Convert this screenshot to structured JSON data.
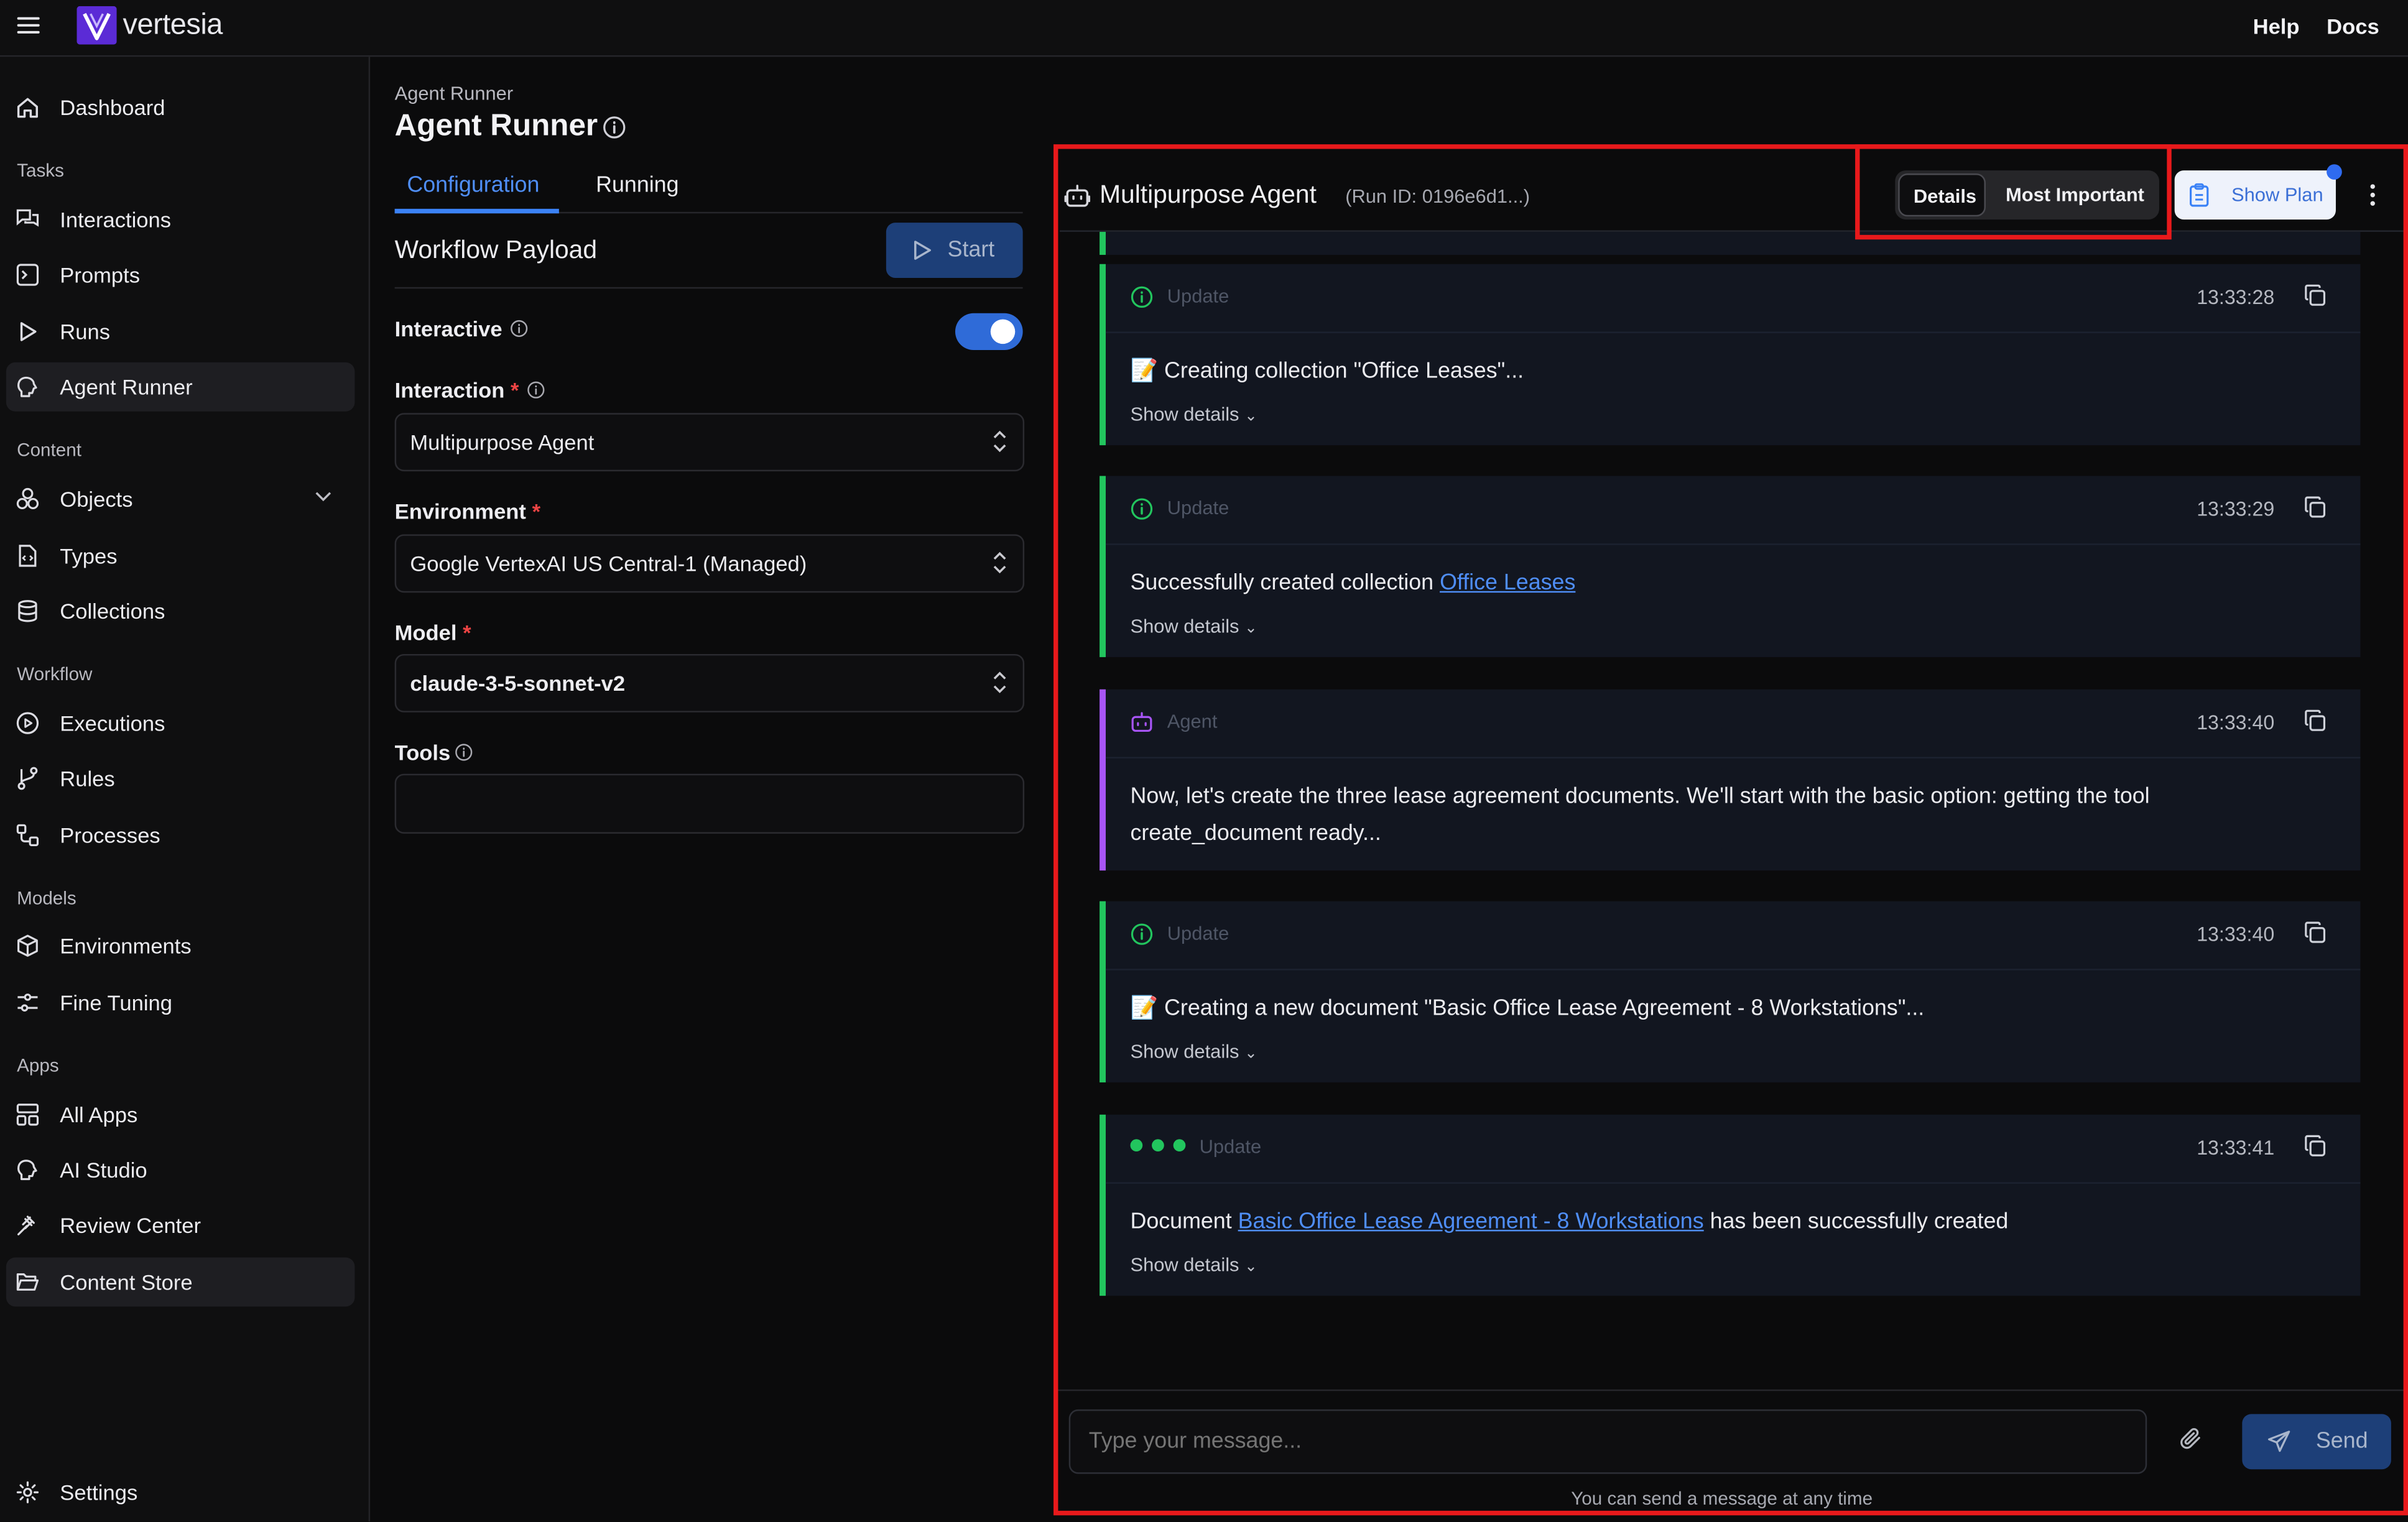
{
  "app": {
    "brand": "vertesia",
    "help": "Help",
    "docs": "Docs"
  },
  "sidebar": {
    "dashboard": "Dashboard",
    "sections": {
      "tasks": "Tasks",
      "content": "Content",
      "workflow": "Workflow",
      "models": "Models",
      "apps": "Apps"
    },
    "tasks": [
      "Interactions",
      "Prompts",
      "Runs",
      "Agent Runner"
    ],
    "content": [
      "Objects",
      "Types",
      "Collections"
    ],
    "workflow": [
      "Executions",
      "Rules",
      "Processes"
    ],
    "models": [
      "Environments",
      "Fine Tuning"
    ],
    "apps": [
      "All Apps",
      "AI Studio",
      "Review Center",
      "Content Store"
    ],
    "settings": "Settings"
  },
  "page": {
    "breadcrumb": "Agent Runner",
    "title": "Agent Runner",
    "tabs": [
      "Configuration",
      "Running"
    ],
    "payload_label": "Workflow Payload",
    "start_label": "Start",
    "interactive_label": "Interactive",
    "interactive_on": true,
    "interaction_label": "Interaction",
    "interaction_value": "Multipurpose Agent",
    "environment_label": "Environment",
    "environment_value": "Google VertexAI US Central-1 (Managed)",
    "model_label": "Model",
    "model_value": "claude-3-5-sonnet-v2",
    "tools_label": "Tools",
    "required_mark": "*"
  },
  "run": {
    "agent_name": "Multipurpose Agent",
    "run_id": "(Run ID: 0196e6d1...)",
    "filters": [
      "Details",
      "Most Important"
    ],
    "show_plan": "Show Plan",
    "messages": [
      {
        "kind": "Update",
        "time": "13:33:28",
        "emoji": "📝",
        "text": "Creating collection \"Office Leases\"...",
        "details": "Show details"
      },
      {
        "kind": "Update",
        "time": "13:33:29",
        "pre": "Successfully created collection ",
        "link": "Office Leases",
        "details": "Show details"
      },
      {
        "kind": "Agent",
        "time": "13:33:40",
        "line1": "Now, let's create the three lease agreement documents. We'll start with the basic option: getting the tool",
        "line2": "create_document ready..."
      },
      {
        "kind": "Update",
        "time": "13:33:40",
        "emoji": "📝",
        "text": "Creating a new document \"Basic Office Lease Agreement - 8 Workstations\"...",
        "details": "Show details"
      },
      {
        "kind": "Update",
        "time": "13:33:41",
        "pre": "Document ",
        "link": "Basic Office Lease Agreement - 8 Workstations",
        "post": " has been successfully created",
        "details": "Show details"
      }
    ],
    "input_placeholder": "Type your message...",
    "send_label": "Send",
    "hint": "You can send a message at any time"
  },
  "colors": {
    "accent": "#3b82f6",
    "update": "#22c55e",
    "agent": "#a855f7",
    "highlight": "#e8191b"
  }
}
